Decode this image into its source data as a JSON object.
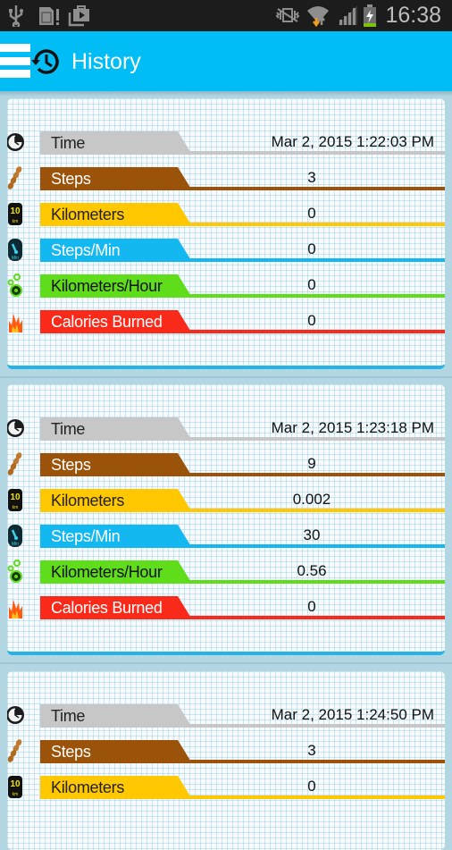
{
  "status_bar": {
    "left_icons": [
      "usb-icon",
      "sd-card-warning-icon",
      "media-store-icon"
    ],
    "right_icons": [
      "vibrate-icon",
      "wifi-icon",
      "signal-icon",
      "battery-charging-icon"
    ],
    "time": "16:38"
  },
  "app_bar": {
    "menu_icon": "hamburger-icon",
    "title_icon": "history-icon",
    "title": "History"
  },
  "colors": {
    "app_bar": "#00bdf6",
    "time": "#c7c7c7",
    "steps": "#9b5209",
    "kilometers": "#ffc800",
    "steps_per_min": "#14b8f0",
    "kilometers_per_hour": "#5fdc1a",
    "calories_burned": "#fa2a1a"
  },
  "labels": {
    "time": "Time",
    "steps": "Steps",
    "kilometers": "Kilometers",
    "steps_per_min": "Steps/Min",
    "kilometers_per_hour": "Kilometers/Hour",
    "calories_burned": "Calories Burned"
  },
  "records": [
    {
      "time": "Mar 2, 2015 1:22:03 PM",
      "steps": "3",
      "kilometers": "0",
      "steps_per_min": "0",
      "kilometers_per_hour": "0",
      "calories_burned": "0"
    },
    {
      "time": "Mar 2, 2015 1:23:18 PM",
      "steps": "9",
      "kilometers": "0.002",
      "steps_per_min": "30",
      "kilometers_per_hour": "0.56",
      "calories_burned": "0"
    },
    {
      "time": "Mar 2, 2015 1:24:50 PM",
      "steps": "3",
      "kilometers": "0"
    }
  ]
}
